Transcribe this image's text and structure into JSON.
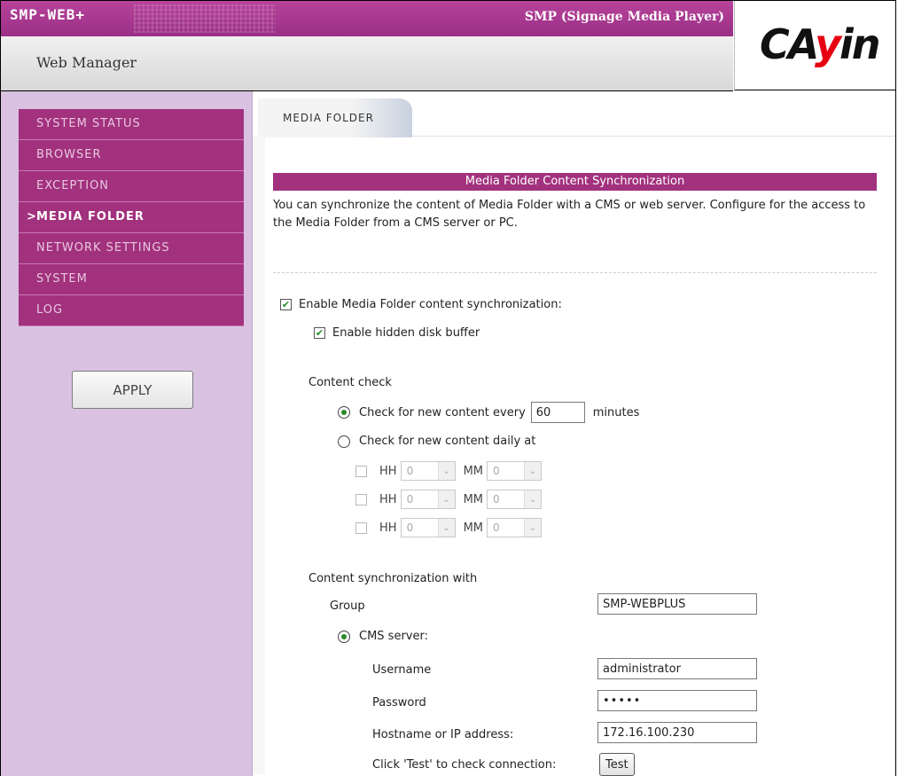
{
  "header": {
    "logo_text": "SMP-WEB+",
    "product": "SMP (Signage Media Player)",
    "subtitle": "Web Manager",
    "brand_left": "CA",
    "brand_y": "y",
    "brand_right": "in"
  },
  "sidebar": {
    "items": [
      {
        "label": "SYSTEM STATUS"
      },
      {
        "label": "BROWSER"
      },
      {
        "label": "EXCEPTION"
      },
      {
        "label": "MEDIA FOLDER"
      },
      {
        "label": "NETWORK SETTINGS"
      },
      {
        "label": "SYSTEM"
      },
      {
        "label": "LOG"
      }
    ],
    "active_arrow": ">",
    "apply_label": "APPLY"
  },
  "tab": {
    "label": "MEDIA FOLDER"
  },
  "section": {
    "title": "Media Folder Content Synchronization",
    "description": "You can synchronize the content of Media Folder with a CMS or web server. Configure for the access to the Media Folder from a CMS server or PC."
  },
  "sync": {
    "enable_label": "Enable Media Folder content synchronization:",
    "enable_checked": true,
    "hidden_buffer_label": "Enable hidden disk buffer",
    "hidden_buffer_checked": true
  },
  "content_check": {
    "heading": "Content check",
    "every_label": "Check for new content every",
    "every_value": "60",
    "every_unit": "minutes",
    "daily_label": "Check for new content daily at",
    "slots": [
      {
        "hh_label": "HH",
        "hh": "0",
        "mm_label": "MM",
        "mm": "0"
      },
      {
        "hh_label": "HH",
        "hh": "0",
        "mm_label": "MM",
        "mm": "0"
      },
      {
        "hh_label": "HH",
        "hh": "0",
        "mm_label": "MM",
        "mm": "0"
      }
    ],
    "check_mark": "✔",
    "chevron": "⌄"
  },
  "sync_with": {
    "heading": "Content synchronization with",
    "group_label": "Group",
    "group_value": "SMP-WEBPLUS",
    "cms_label": "CMS server:",
    "username_label": "Username",
    "username_value": "administrator",
    "password_label": "Password",
    "password_value": "•••••",
    "host_label": "Hostname or IP address:",
    "host_value": "172.16.100.230",
    "test_hint": "Click 'Test' to check connection:",
    "test_label": "Test"
  }
}
